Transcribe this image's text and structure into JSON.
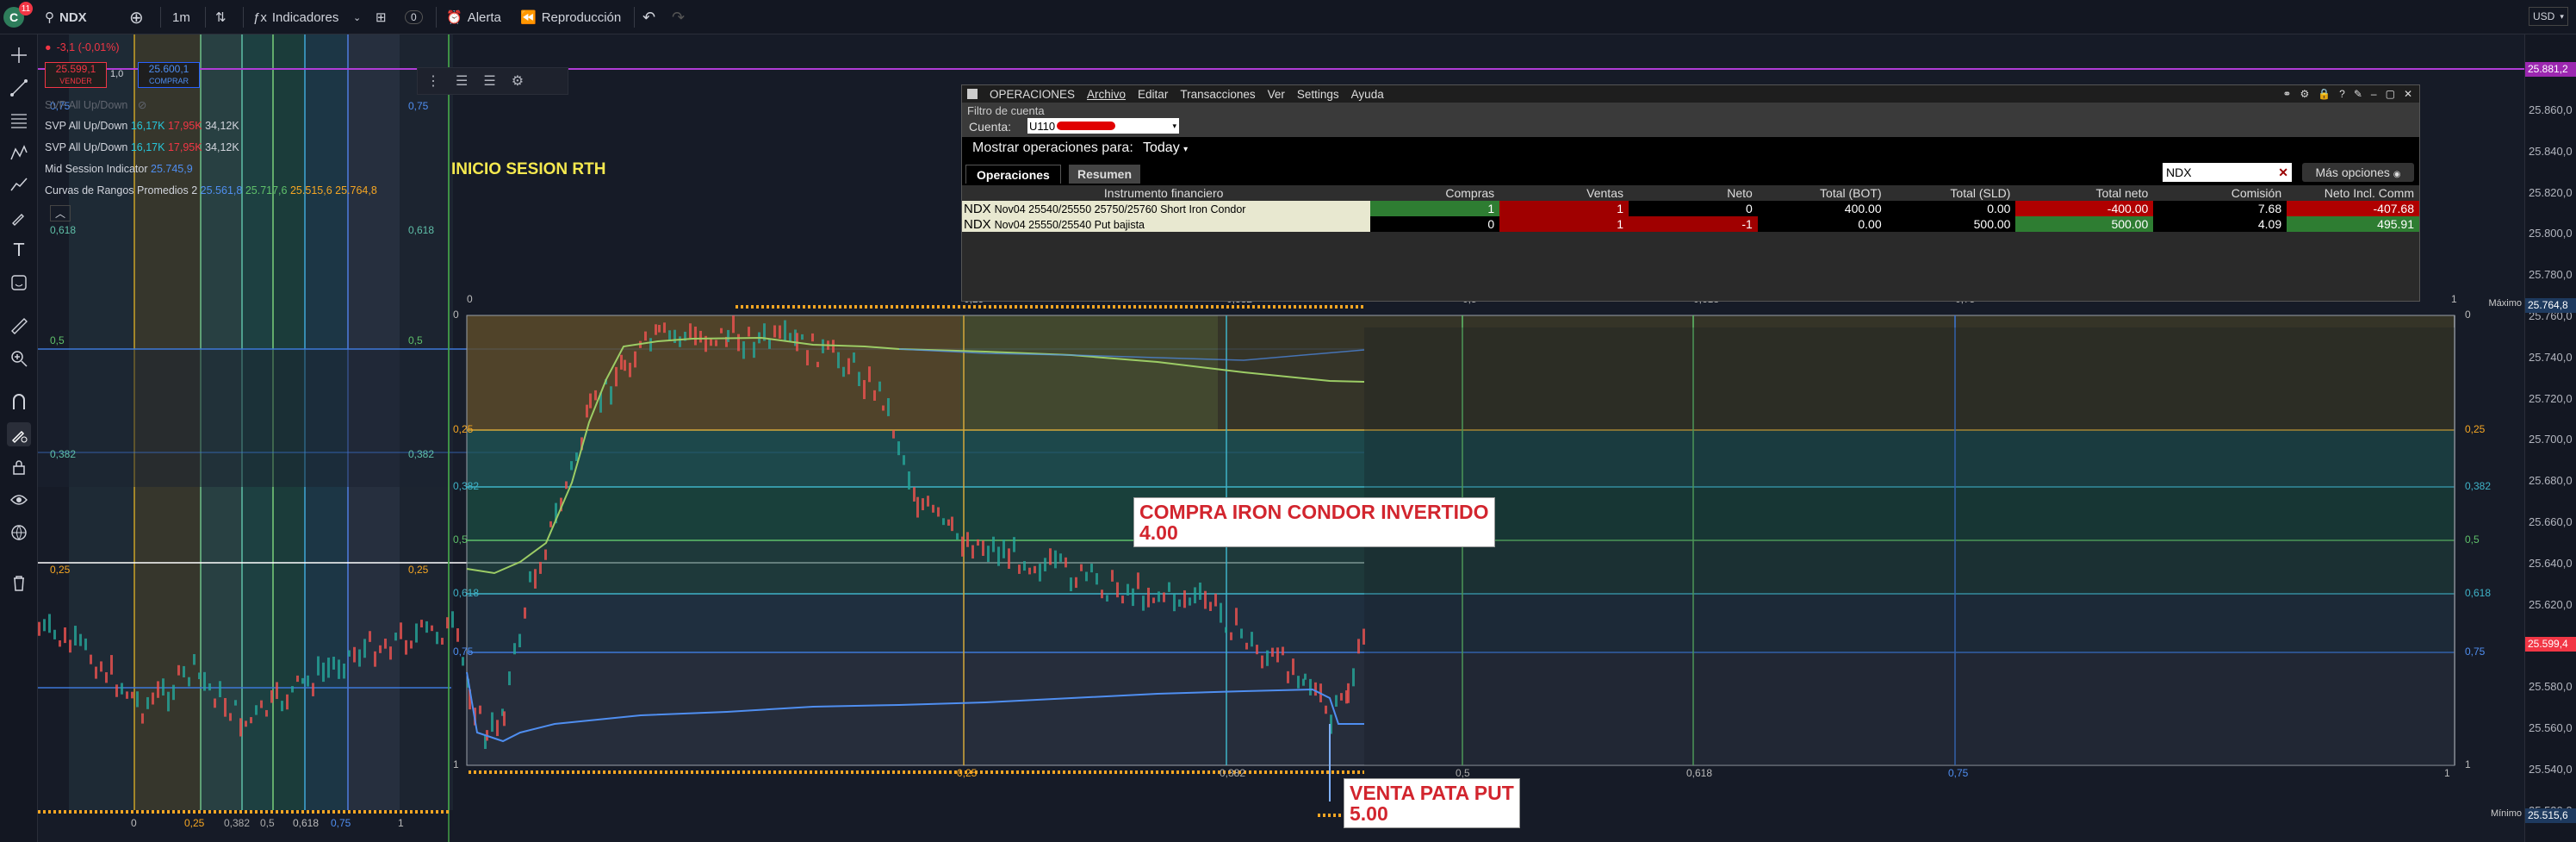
{
  "topbar": {
    "avatar_letter": "C",
    "avatar_badge": "11",
    "symbol": "NDX",
    "interval": "1m",
    "indicators": "Indicadores",
    "layouts_count": "0",
    "alert": "Alerta",
    "replay": "Reproducción",
    "currency": "USD"
  },
  "legend": {
    "change": "-3,1 (-0,01%)",
    "sell_price": "25.599,1",
    "sell_label": "VENDER",
    "qty": "1,0",
    "buy_price": "25.600,1",
    "buy_label": "COMPRAR",
    "indicators": [
      {
        "name": "SVP All Up/Down",
        "v1": "",
        "v2": "",
        "v3": ""
      },
      {
        "name": "SVP All Up/Down",
        "v1": "16,17K",
        "v2": "17,95K",
        "v3": "34,12K"
      },
      {
        "name": "SVP All Up/Down",
        "v1": "16,17K",
        "v2": "17,95K",
        "v3": "34,12K"
      },
      {
        "name": "Mid Session Indicator",
        "v1": "25.745,9",
        "v2": "",
        "v3": ""
      },
      {
        "name": "Curvas de Rangos Promedios 2",
        "v1": "25.561,8",
        "v2": "25.717,6",
        "v3": "25.515,6",
        "v4": "25.764,8"
      }
    ]
  },
  "chart_labels": {
    "session_start": "INICIO SESION RTH",
    "buy_note_line1": "COMPRA IRON CONDOR INVERTIDO",
    "buy_note_line2": "4.00",
    "sell_note_line1": "VENTA PATA PUT",
    "sell_note_line2": "5.00"
  },
  "fib_levels": {
    "left_x": [
      "0",
      "0,25",
      "0,382",
      "0,5",
      "0,618",
      "0,75",
      "1"
    ],
    "left_y": [
      "0,75",
      "0,618",
      "0,5",
      "0,382",
      "0,25"
    ],
    "mid_y": [
      "0,75",
      "0,618",
      "0,5",
      "0,382",
      "0,25"
    ],
    "right_x": [
      "0",
      "0,25",
      "0,382",
      "0,5",
      "0,618",
      "0,75",
      "1"
    ],
    "right_y": [
      "0",
      "0,25",
      "0,382",
      "0,5",
      "0,618",
      "0,75",
      "1"
    ],
    "rect_y_left": [
      "0",
      "0,25",
      "0,382",
      "0,5",
      "0,618",
      "0,75",
      "1"
    ]
  },
  "price_axis": {
    "ticks": [
      "25.860,0",
      "25.840,0",
      "25.820,0",
      "25.800,0",
      "25.780,0",
      "25.760,0",
      "25.740,0",
      "25.720,0",
      "25.700,0",
      "25.680,0",
      "25.660,0",
      "25.640,0",
      "25.620,0",
      "25.600,0",
      "25.580,0",
      "25.560,0",
      "25.540,0",
      "25.520,0"
    ],
    "top_badge": "25.881,2",
    "max_label": "Máximo",
    "max_value": "25.764,8",
    "current_value": "25.599,4",
    "min_label": "Mínimo",
    "min_value": "25.515,6"
  },
  "ops_window": {
    "title": "OPERACIONES",
    "menu": [
      "Archivo",
      "Editar",
      "Transacciones",
      "Ver",
      "Settings",
      "Ayuda"
    ],
    "filter_title": "Filtro de cuenta",
    "account_label": "Cuenta:",
    "account_value": "U110",
    "show_label": "Mostrar operaciones para:",
    "show_value": "Today",
    "tabs": [
      "Operaciones",
      "Resumen"
    ],
    "search_value": "NDX",
    "more_options": "Más opciones",
    "columns": [
      "Instrumento financiero",
      "Compras",
      "Ventas",
      "Neto",
      "Total (BOT)",
      "Total (SLD)",
      "Total neto",
      "Comisión",
      "Neto Incl. Comm"
    ],
    "rows": [
      {
        "sym": "NDX",
        "desc": "Nov04 25540/25550 25750/25760 Short Iron Condor",
        "buys": "1",
        "sells": "1",
        "net": "0",
        "bot": "400.00",
        "sld": "0.00",
        "total_net": "-400.00",
        "comm": "7.68",
        "net_comm": "-407.68"
      },
      {
        "sym": "NDX",
        "desc": "Nov04 25550/25540 Put bajista",
        "buys": "0",
        "sells": "1",
        "net": "-1",
        "bot": "0.00",
        "sld": "500.00",
        "total_net": "500.00",
        "comm": "4.09",
        "net_comm": "495.91"
      }
    ]
  }
}
